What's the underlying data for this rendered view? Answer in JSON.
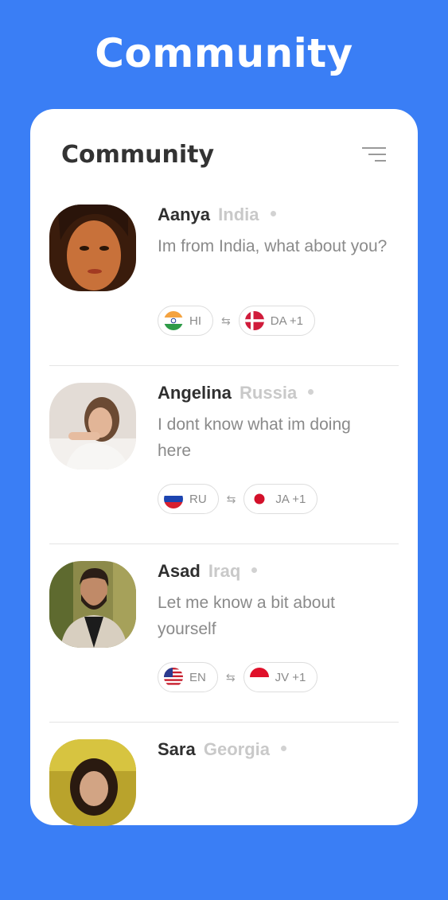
{
  "header": {
    "title": "Community"
  },
  "card": {
    "title": "Community",
    "filter_icon": "filter-lines-icon"
  },
  "users": [
    {
      "name": "Aanya",
      "country": "India",
      "message": "Im from India, what about you?",
      "native": {
        "code": "HI",
        "flag": "flag-india-icon"
      },
      "learning": {
        "code": "DA +1",
        "flag": "flag-denmark-icon"
      }
    },
    {
      "name": "Angelina",
      "country": "Russia",
      "message": "I dont know what im doing here",
      "native": {
        "code": "RU",
        "flag": "flag-russia-icon"
      },
      "learning": {
        "code": "JA +1",
        "flag": "flag-japan-icon"
      }
    },
    {
      "name": "Asad",
      "country": "Iraq",
      "message": "Let me know a bit about yourself",
      "native": {
        "code": "EN",
        "flag": "flag-usa-icon"
      },
      "learning": {
        "code": "JV +1",
        "flag": "flag-indonesia-icon"
      }
    },
    {
      "name": "Sara",
      "country": "Georgia"
    }
  ],
  "colors": {
    "background": "#3a7ef5",
    "card": "#ffffff",
    "name": "#2f2f2f",
    "country": "#c9c9c9",
    "message": "#8a8a8a"
  }
}
